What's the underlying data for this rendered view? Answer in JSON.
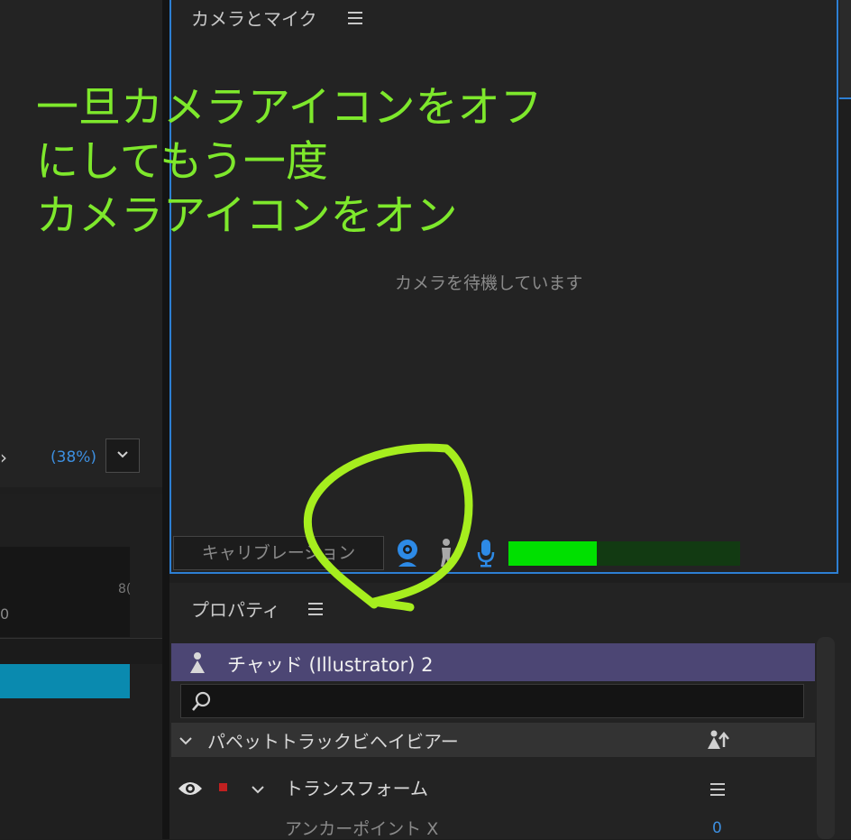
{
  "annotation": {
    "text": "一旦カメラアイコンをオフ\nにしてもう一度\nカメラアイコンをオン",
    "color": "#7ee82c"
  },
  "left_panel": {
    "zoom_label": "(38%)",
    "ruler_tick": "8(",
    "ruler_zero": "0"
  },
  "camera_panel": {
    "title": "カメラとマイク",
    "waiting_text": "カメラを待機しています",
    "calibration_label": "キャリブレーション",
    "level": 0.38,
    "icons": [
      "webcam-icon",
      "body-tracking-icon",
      "microphone-icon"
    ]
  },
  "properties_panel": {
    "title": "プロパティ",
    "puppet_name": "チャッド (Illustrator) 2",
    "search_placeholder": "",
    "behavior_label": "パペットトラックビヘイビアー",
    "transform_label": "トランスフォーム",
    "anchor_label": "アンカーポイント X",
    "anchor_value": "0"
  },
  "colors": {
    "accent": "#2d7fd3",
    "puppet_header": "#4c4674",
    "meter_fill": "#00e000",
    "clip": "#0a8aaf"
  }
}
